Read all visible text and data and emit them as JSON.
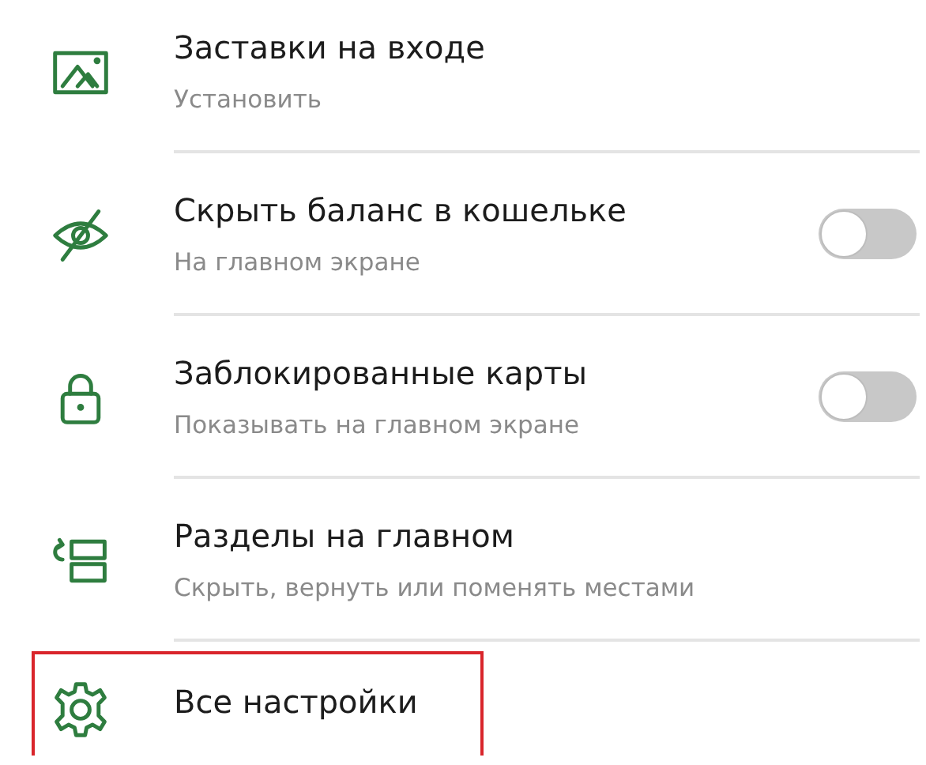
{
  "settings": [
    {
      "kind": "link",
      "title": "Заставки на входе",
      "subtitle": "Установить",
      "highlighted": false
    },
    {
      "kind": "toggle",
      "title": "Скрыть баланс в кошельке",
      "subtitle": "На главном экране",
      "on": false,
      "highlighted": false
    },
    {
      "kind": "toggle",
      "title": "Заблокированные карты",
      "subtitle": "Показывать на главном экране",
      "on": false,
      "highlighted": false
    },
    {
      "kind": "link",
      "title": "Разделы на главном",
      "subtitle": "Скрыть, вернуть или поменять местами",
      "highlighted": false
    },
    {
      "kind": "link",
      "title": "Все настройки",
      "highlighted": true
    }
  ]
}
